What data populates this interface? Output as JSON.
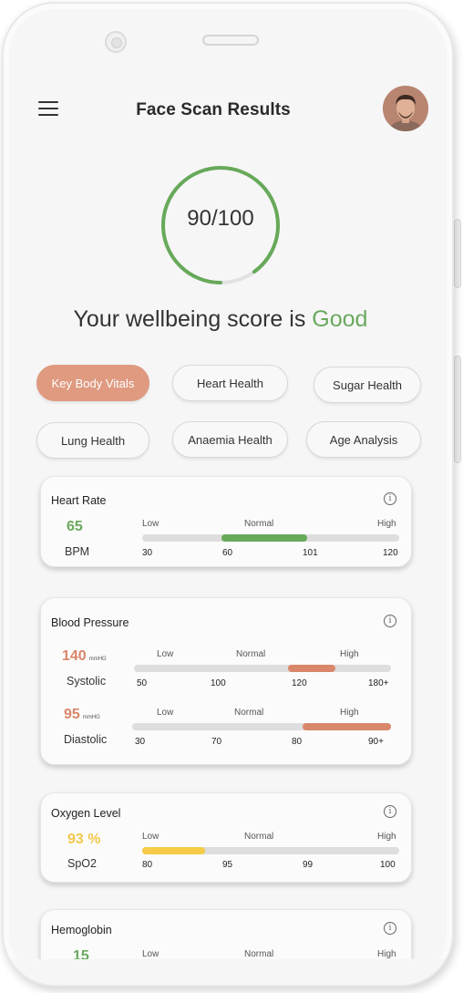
{
  "header": {
    "title": "Face Scan Results",
    "menu_icon": "hamburger-menu-icon",
    "avatar": "user-avatar"
  },
  "score": {
    "text": "90/100",
    "value": 90,
    "max": 100,
    "ring_color": "#67a95a",
    "prefix": "Your wellbeing score is",
    "rating": "Good",
    "rating_color": "#6aaa5e"
  },
  "tabs": [
    {
      "label": "Key Body Vitals",
      "active": true
    },
    {
      "label": "Heart Health",
      "active": false
    },
    {
      "label": "Sugar Health",
      "active": false
    },
    {
      "label": "Lung Health",
      "active": false
    },
    {
      "label": "Anaemia Health",
      "active": false
    },
    {
      "label": "Age Analysis",
      "active": false
    }
  ],
  "colors": {
    "accent": "#df9a80",
    "normal": "#67a95a",
    "high": "#d9876b",
    "low": "#f6cb48",
    "track": "#dedede"
  },
  "cards": {
    "heart_rate": {
      "title": "Heart Rate",
      "value": "65",
      "unit": "BPM",
      "zones": [
        "Low",
        "Normal",
        "High"
      ],
      "ticks": [
        "30",
        "60",
        "101",
        "120"
      ]
    },
    "blood_pressure": {
      "title": "Blood Pressure",
      "systolic": {
        "value": "140",
        "unit": "mmHG",
        "label": "Systolic",
        "zones": [
          "Low",
          "Normal",
          "High"
        ],
        "ticks": [
          "50",
          "100",
          "120",
          "180+"
        ]
      },
      "diastolic": {
        "value": "95",
        "unit": "mmHG",
        "label": "Diastolic",
        "zones": [
          "Low",
          "Normal",
          "High"
        ],
        "ticks": [
          "30",
          "70",
          "80",
          "90+"
        ]
      }
    },
    "oxygen": {
      "title": "Oxygen Level",
      "value": "93 %",
      "label": "SpO2",
      "zones": [
        "Low",
        "Normal",
        "High"
      ],
      "ticks": [
        "80",
        "95",
        "99",
        "100"
      ]
    },
    "hemoglobin": {
      "title": "Hemoglobin",
      "value": "15",
      "zones": [
        "Low",
        "Normal",
        "High"
      ]
    }
  }
}
